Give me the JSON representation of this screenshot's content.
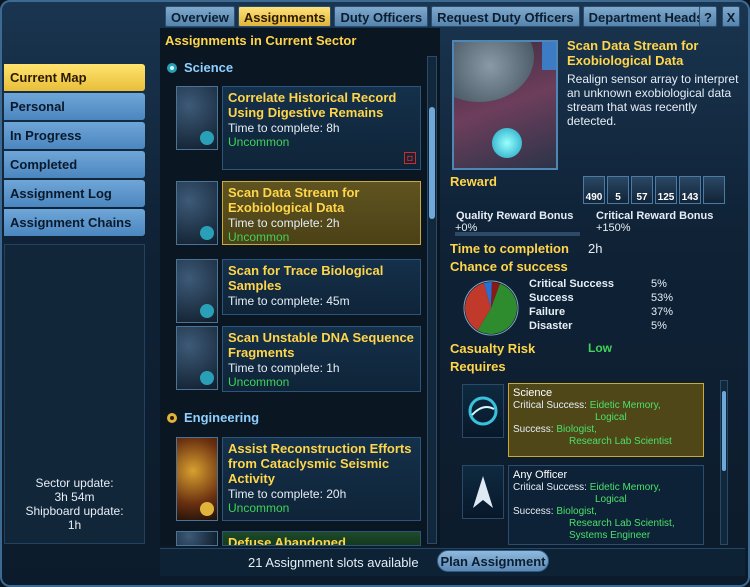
{
  "tabs": [
    {
      "label": "Overview",
      "active": false
    },
    {
      "label": "Assignments",
      "active": true
    },
    {
      "label": "Duty Officers",
      "active": false
    },
    {
      "label": "Request Duty Officers",
      "active": false
    },
    {
      "label": "Department Heads",
      "active": false
    }
  ],
  "top_buttons": {
    "help": "?",
    "close": "X"
  },
  "left_nav": [
    {
      "label": "Current Map",
      "active": true
    },
    {
      "label": "Personal",
      "active": false
    },
    {
      "label": "In Progress",
      "active": false
    },
    {
      "label": "Completed",
      "active": false
    },
    {
      "label": "Assignment Log",
      "active": false
    },
    {
      "label": "Assignment Chains",
      "active": false
    }
  ],
  "sector_info": {
    "sector_label": "Sector update:",
    "sector_value": "3h 54m",
    "shipboard_label": "Shipboard update:",
    "shipboard_value": "1h"
  },
  "middle": {
    "title": "Assignments in Current Sector",
    "categories": [
      {
        "label": "Science",
        "icon": "science-icon"
      },
      {
        "label": "Engineering",
        "icon": "engineering-icon"
      }
    ],
    "assignments": [
      {
        "title": "Correlate Historical Record Using Digestive Remains",
        "time": "Time to complete: 8h",
        "rarity": "Uncommon"
      },
      {
        "title": "Scan Data Stream for Exobiological Data",
        "time": "Time to complete: 2h",
        "rarity": "Uncommon"
      },
      {
        "title": "Scan for Trace Biological Samples",
        "time": "Time to complete: 45m",
        "rarity": ""
      },
      {
        "title": "Scan Unstable DNA Sequence Fragments",
        "time": "Time to complete: 1h",
        "rarity": "Uncommon"
      },
      {
        "title": "Assist Reconstruction Efforts from Cataclysmic Seismic Activity",
        "time": "Time to complete: 20h",
        "rarity": "Uncommon"
      },
      {
        "title": "Defuse Abandoned",
        "time": "",
        "rarity": ""
      }
    ]
  },
  "bottom": {
    "slots": "21 Assignment slots available",
    "plan_button": "Plan Assignment"
  },
  "detail": {
    "title": "Scan Data Stream for Exobiological Data",
    "description": "Realign sensor array to interpret an unknown exobiological data stream that was recently detected.",
    "reward_label": "Reward",
    "rewards": [
      {
        "icon": "dilithium-icon",
        "value": "490"
      },
      {
        "icon": "lobi-icon",
        "value": "5"
      },
      {
        "icon": "science-xp-icon",
        "value": "57"
      },
      {
        "icon": "experience-icon",
        "value": "125"
      },
      {
        "icon": "skill-icon",
        "value": "143"
      },
      {
        "icon": "reward-pack-icon",
        "value": ""
      }
    ],
    "quality_bonus_label": "Quality Reward Bonus",
    "quality_bonus_value": "+0%",
    "critical_bonus_label": "Critical Reward Bonus",
    "critical_bonus_value": "+150%",
    "time_label": "Time to completion",
    "time_value": "2h",
    "chance_label": "Chance of success",
    "odds": [
      {
        "label": "Critical Success",
        "value": "5%"
      },
      {
        "label": "Success",
        "value": "53%"
      },
      {
        "label": "Failure",
        "value": "37%"
      },
      {
        "label": "Disaster",
        "value": "5%"
      }
    ],
    "casualty_label": "Casualty Risk",
    "casualty_value": "Low",
    "requires_label": "Requires",
    "requirements": [
      {
        "title": "Science",
        "critical_label": "Critical Success:",
        "critical_traits": [
          "Eidetic Memory,",
          "Logical"
        ],
        "success_label": "Success:",
        "success_traits": [
          "Biologist,",
          "Research Lab Scientist"
        ]
      },
      {
        "title": "Any Officer",
        "critical_label": "Critical Success:",
        "critical_traits": [
          "Eidetic Memory,",
          "Logical"
        ],
        "success_label": "Success:",
        "success_traits": [
          "Biologist,",
          "Research Lab Scientist,",
          "Systems Engineer"
        ]
      }
    ]
  },
  "colors": {
    "accent_gold": "#ffd54a",
    "rarity_green": "#3fd35a",
    "pie_success": "#2e8b2e",
    "pie_failure": "#c0392b",
    "pie_critical": "#2a6fd1",
    "pie_disaster": "#8a1a1a"
  }
}
